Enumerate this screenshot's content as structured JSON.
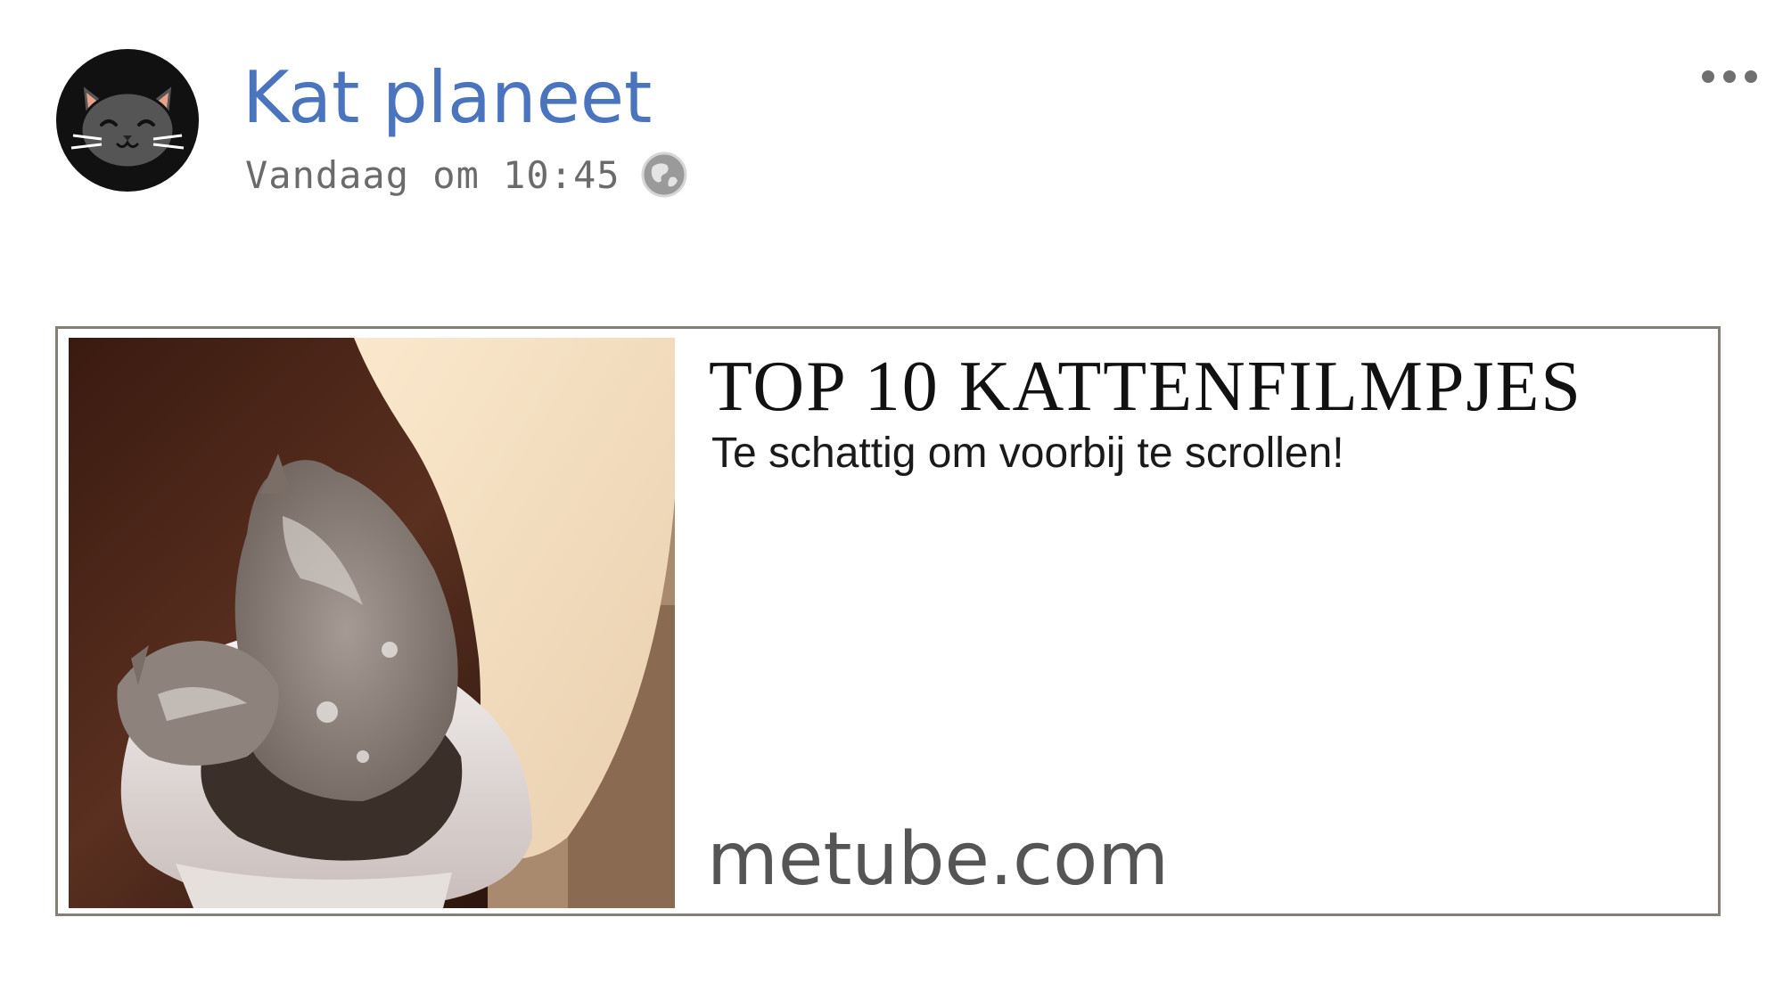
{
  "post": {
    "page_name": "Kat planeet",
    "timestamp": "Vandaag om 10:45",
    "avatar_icon": "cat-face-icon",
    "privacy_icon": "globe-icon",
    "menu_icon": "more-options-icon"
  },
  "link_preview": {
    "title": "TOP 10 KATTENFILMPJES",
    "subtitle": "Te schattig om voorbij te scrollen!",
    "domain": "metube.com",
    "image_subject": "cat-in-toilet-photo"
  },
  "colors": {
    "page_name": "#4a74bd",
    "timestamp": "#6b6b6b",
    "card_border": "#857f7a",
    "avatar_bg": "#111111",
    "cat_fur": "#555555"
  }
}
